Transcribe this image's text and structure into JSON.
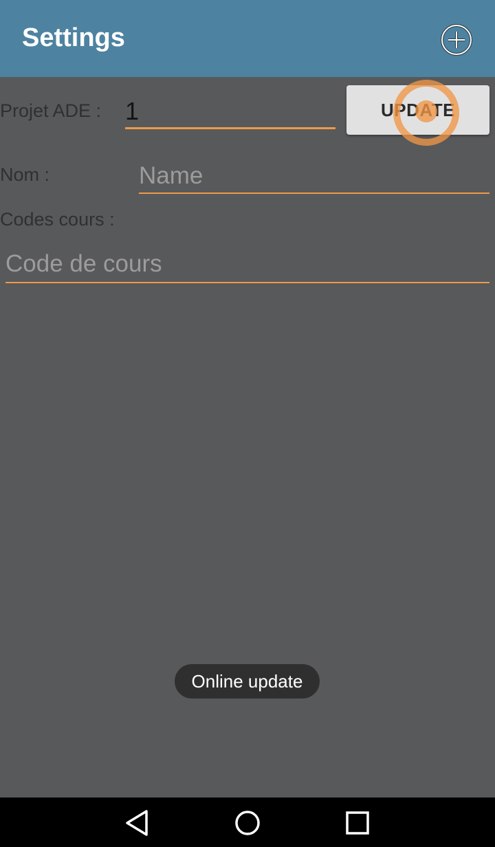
{
  "appbar": {
    "title": "Settings",
    "add_icon": "circle-plus-icon"
  },
  "form": {
    "project_label": "Projet ADE :",
    "project_value": "1",
    "update_button": "UPDATE",
    "name_label": "Nom  :",
    "name_placeholder": "Name",
    "name_value": "",
    "codes_label": "Codes cours :",
    "codes_placeholder": "Code de cours",
    "codes_value": ""
  },
  "toast": {
    "message": "Online update"
  },
  "navbar": {
    "back_icon": "triangle-back-icon",
    "home_icon": "circle-home-icon",
    "recent_icon": "square-recents-icon"
  },
  "colors": {
    "appbar": "#4d83a0",
    "background": "#58595b",
    "accent": "#ee9a4a",
    "button": "#e1e1e1",
    "toast": "#2f2f2f"
  }
}
